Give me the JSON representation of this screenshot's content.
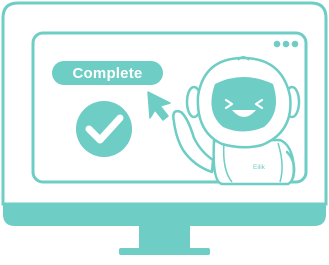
{
  "status": {
    "label": "Complete"
  },
  "robot": {
    "name": "Eilik"
  },
  "window": {
    "dots": [
      "dot-1",
      "dot-2",
      "dot-3"
    ]
  },
  "icons": {
    "check": "check-circle-icon",
    "cursor": "cursor-arrow-icon",
    "robot": "robot-mascot-icon",
    "monitor": "monitor-icon"
  },
  "colors": {
    "accent": "#6ecdc4",
    "line": "#6ecdc4",
    "fill": "#ffffff"
  }
}
